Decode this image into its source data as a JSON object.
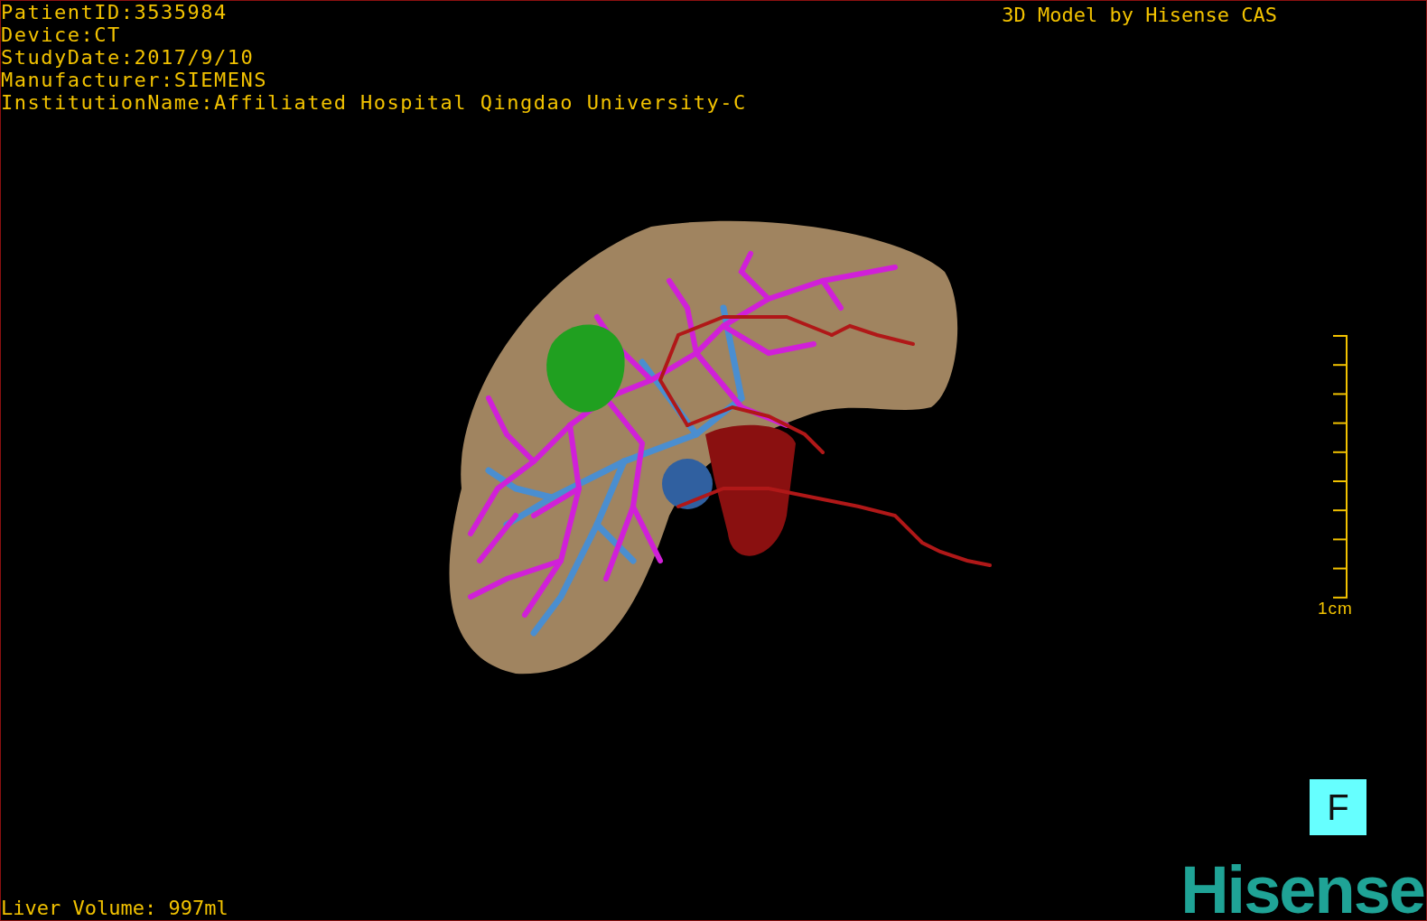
{
  "info_lines": [
    "PatientID:3535984",
    "Device:CT",
    "StudyDate:2017/9/10",
    "Manufacturer:SIEMENS",
    "InstitutionName:Affiliated Hospital Qingdao University-C"
  ],
  "credit": "3D Model by Hisense CAS",
  "scale_bar": {
    "label": "1cm"
  },
  "orientation_marker": "F",
  "liver_volume": "Liver Volume: 997ml",
  "logo": "Hisense"
}
